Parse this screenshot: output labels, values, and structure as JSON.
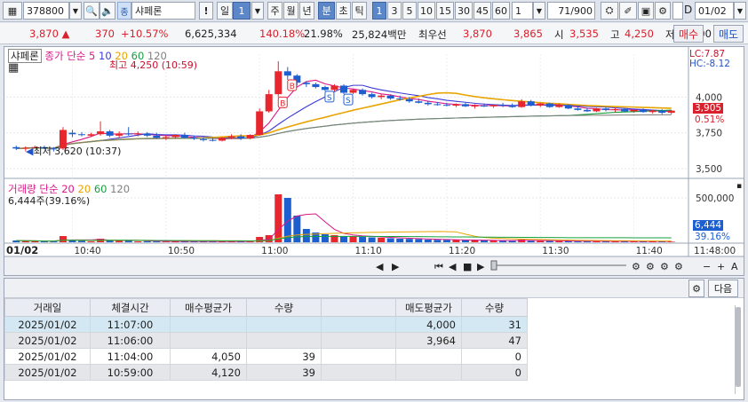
{
  "toolbar": {
    "code": "378800",
    "stock_name": "샤페론",
    "period_day": "일",
    "period_num": "1",
    "periods": [
      "주",
      "월",
      "년",
      "분",
      "초",
      "틱"
    ],
    "intervals": [
      "1",
      "3",
      "5",
      "10",
      "15",
      "30",
      "45",
      "60"
    ],
    "interval_select": "1",
    "count": "71",
    "count_max": "/900",
    "date": "01/02",
    "checkbox_label": "D"
  },
  "quote": {
    "price": "3,870",
    "change": "370",
    "change_pct": "+10.57%",
    "volume": "6,625,334",
    "vol_ratio": "140.18%",
    "turnover": "21.98%",
    "amount": "25,824백만",
    "ask_label": "최우선",
    "ask": "3,870",
    "bid": "3,865",
    "open_label": "시",
    "open": "3,535",
    "high_label": "고",
    "high": "4,250",
    "low_label": "저",
    "low": "3,500",
    "buy_label": "매수",
    "sell_label": "매도"
  },
  "chart": {
    "stock_tag": "샤페론",
    "legend_price": "종가 단순",
    "ma_periods": [
      "5",
      "10",
      "20",
      "60",
      "120"
    ],
    "high_note": "최고 4,250 (10:59)",
    "low_note": "최저 3,620 (10:37)",
    "lc": "LC:7.87",
    "hc": "HC:-8.12",
    "price_badge": "3,905",
    "pct_badge": "0.51%",
    "vol_legend": "거래량 단순",
    "vol_value": "6,444주(39.16%)",
    "vol_badge": "6,444",
    "vol_pct": "39.16%",
    "x_date": "01/02",
    "markers": [
      "B",
      "B",
      "S",
      "S"
    ],
    "colors": {
      "up": "#e8262d",
      "down": "#1e5fd0",
      "ma5": "#d9198a",
      "ma10": "#3b3bd6",
      "ma20": "#e8a400",
      "ma60": "#15a03c",
      "ma120": "#808080"
    }
  },
  "chart_data": [
    {
      "type": "candlestick",
      "title": "",
      "x": [
        "10:40",
        "10:50",
        "11:00",
        "11:10",
        "11:20",
        "11:30",
        "11:40",
        "11:48:00"
      ],
      "ylim": [
        3450,
        4300
      ],
      "yticks": [
        3500,
        3750,
        4000
      ],
      "y_tick_labels": [
        "3,500",
        "3,750",
        "4,000"
      ],
      "candles": [
        {
          "o": 3650,
          "h": 3660,
          "l": 3630,
          "c": 3640
        },
        {
          "o": 3640,
          "h": 3655,
          "l": 3620,
          "c": 3645
        },
        {
          "o": 3645,
          "h": 3660,
          "l": 3640,
          "c": 3650
        },
        {
          "o": 3650,
          "h": 3660,
          "l": 3635,
          "c": 3640
        },
        {
          "o": 3640,
          "h": 3650,
          "l": 3620,
          "c": 3635
        },
        {
          "o": 3640,
          "h": 3790,
          "l": 3630,
          "c": 3770
        },
        {
          "o": 3750,
          "h": 3770,
          "l": 3720,
          "c": 3740
        },
        {
          "o": 3740,
          "h": 3755,
          "l": 3725,
          "c": 3735
        },
        {
          "o": 3730,
          "h": 3750,
          "l": 3720,
          "c": 3740
        },
        {
          "o": 3740,
          "h": 3830,
          "l": 3730,
          "c": 3760
        },
        {
          "o": 3760,
          "h": 3770,
          "l": 3720,
          "c": 3730
        },
        {
          "o": 3730,
          "h": 3760,
          "l": 3715,
          "c": 3745
        },
        {
          "o": 3745,
          "h": 3790,
          "l": 3730,
          "c": 3740
        },
        {
          "o": 3740,
          "h": 3760,
          "l": 3725,
          "c": 3745
        },
        {
          "o": 3745,
          "h": 3755,
          "l": 3720,
          "c": 3730
        },
        {
          "o": 3730,
          "h": 3750,
          "l": 3710,
          "c": 3715
        },
        {
          "o": 3715,
          "h": 3735,
          "l": 3700,
          "c": 3720
        },
        {
          "o": 3720,
          "h": 3740,
          "l": 3710,
          "c": 3735
        },
        {
          "o": 3735,
          "h": 3750,
          "l": 3710,
          "c": 3715
        },
        {
          "o": 3715,
          "h": 3730,
          "l": 3700,
          "c": 3710
        },
        {
          "o": 3705,
          "h": 3720,
          "l": 3690,
          "c": 3700
        },
        {
          "o": 3700,
          "h": 3715,
          "l": 3690,
          "c": 3695
        },
        {
          "o": 3695,
          "h": 3720,
          "l": 3690,
          "c": 3715
        },
        {
          "o": 3715,
          "h": 3740,
          "l": 3705,
          "c": 3725
        },
        {
          "o": 3725,
          "h": 3740,
          "l": 3700,
          "c": 3710
        },
        {
          "o": 3710,
          "h": 3740,
          "l": 3705,
          "c": 3735
        },
        {
          "o": 3735,
          "h": 3920,
          "l": 3730,
          "c": 3900
        },
        {
          "o": 3900,
          "h": 4050,
          "l": 3890,
          "c": 4020
        },
        {
          "o": 4020,
          "h": 4250,
          "l": 4000,
          "c": 4180
        },
        {
          "o": 4180,
          "h": 4210,
          "l": 4120,
          "c": 4150
        },
        {
          "o": 4150,
          "h": 4160,
          "l": 4080,
          "c": 4100
        },
        {
          "o": 4100,
          "h": 4110,
          "l": 4070,
          "c": 4090
        },
        {
          "o": 4090,
          "h": 4100,
          "l": 4060,
          "c": 4070
        },
        {
          "o": 4070,
          "h": 4080,
          "l": 4040,
          "c": 4050
        },
        {
          "o": 4050,
          "h": 4090,
          "l": 4040,
          "c": 4080
        },
        {
          "o": 4080,
          "h": 4090,
          "l": 4020,
          "c": 4030
        },
        {
          "o": 4030,
          "h": 4060,
          "l": 4020,
          "c": 4050
        },
        {
          "o": 4050,
          "h": 4060,
          "l": 4010,
          "c": 4020
        },
        {
          "o": 4020,
          "h": 4030,
          "l": 3990,
          "c": 4000
        },
        {
          "o": 4000,
          "h": 4020,
          "l": 3985,
          "c": 4010
        },
        {
          "o": 4010,
          "h": 4020,
          "l": 3980,
          "c": 3990
        },
        {
          "o": 3990,
          "h": 4010,
          "l": 3975,
          "c": 3985
        },
        {
          "o": 3985,
          "h": 4000,
          "l": 3960,
          "c": 3970
        },
        {
          "o": 3970,
          "h": 3990,
          "l": 3955,
          "c": 3960
        },
        {
          "o": 3960,
          "h": 3975,
          "l": 3940,
          "c": 3950
        },
        {
          "o": 3950,
          "h": 3965,
          "l": 3940,
          "c": 3945
        },
        {
          "o": 3945,
          "h": 3960,
          "l": 3935,
          "c": 3940
        },
        {
          "o": 3940,
          "h": 3955,
          "l": 3930,
          "c": 3950
        },
        {
          "o": 3950,
          "h": 3960,
          "l": 3930,
          "c": 3935
        },
        {
          "o": 3935,
          "h": 3950,
          "l": 3920,
          "c": 3940
        },
        {
          "o": 3940,
          "h": 3955,
          "l": 3930,
          "c": 3935
        },
        {
          "o": 3935,
          "h": 3950,
          "l": 3925,
          "c": 3945
        },
        {
          "o": 3945,
          "h": 3960,
          "l": 3930,
          "c": 3940
        },
        {
          "o": 3940,
          "h": 3955,
          "l": 3925,
          "c": 3930
        },
        {
          "o": 3930,
          "h": 3985,
          "l": 3925,
          "c": 3970
        },
        {
          "o": 3970,
          "h": 3980,
          "l": 3935,
          "c": 3940
        },
        {
          "o": 3940,
          "h": 3960,
          "l": 3930,
          "c": 3955
        },
        {
          "o": 3955,
          "h": 3960,
          "l": 3925,
          "c": 3930
        },
        {
          "o": 3930,
          "h": 3955,
          "l": 3925,
          "c": 3945
        },
        {
          "o": 3945,
          "h": 3950,
          "l": 3915,
          "c": 3920
        },
        {
          "o": 3920,
          "h": 3940,
          "l": 3905,
          "c": 3910
        },
        {
          "o": 3910,
          "h": 3925,
          "l": 3895,
          "c": 3900
        },
        {
          "o": 3900,
          "h": 3925,
          "l": 3895,
          "c": 3920
        },
        {
          "o": 3920,
          "h": 3930,
          "l": 3900,
          "c": 3910
        },
        {
          "o": 3910,
          "h": 3925,
          "l": 3895,
          "c": 3915
        },
        {
          "o": 3915,
          "h": 3920,
          "l": 3895,
          "c": 3900
        },
        {
          "o": 3900,
          "h": 3915,
          "l": 3890,
          "c": 3910
        },
        {
          "o": 3910,
          "h": 3920,
          "l": 3890,
          "c": 3895
        },
        {
          "o": 3895,
          "h": 3910,
          "l": 3885,
          "c": 3905
        },
        {
          "o": 3905,
          "h": 3915,
          "l": 3880,
          "c": 3890
        },
        {
          "o": 3890,
          "h": 3910,
          "l": 3880,
          "c": 3905
        }
      ]
    },
    {
      "type": "bar",
      "title": "",
      "ylim": [
        0,
        560000
      ],
      "yticks": [
        500000
      ],
      "y_tick_labels": [
        "500,000"
      ],
      "values": [
        20000,
        15000,
        12000,
        10000,
        9000,
        70000,
        30000,
        15000,
        10000,
        40000,
        20000,
        15000,
        25000,
        10000,
        12000,
        9000,
        8000,
        10000,
        12000,
        9000,
        7000,
        6000,
        9000,
        11000,
        8000,
        10000,
        60000,
        80000,
        540000,
        500000,
        300000,
        150000,
        110000,
        90000,
        80000,
        70000,
        65000,
        60000,
        55000,
        50000,
        45000,
        40000,
        38000,
        35000,
        30000,
        28000,
        26000,
        25000,
        24000,
        22000,
        20000,
        19000,
        18000,
        17000,
        30000,
        16000,
        15000,
        14000,
        14000,
        13000,
        12000,
        12000,
        11000,
        11000,
        10000,
        10000,
        10000,
        9000,
        9000,
        9000,
        6444
      ]
    }
  ],
  "table": {
    "headers": [
      "거래일",
      "체결시간",
      "매수평균가",
      "수량",
      "",
      "매도평균가",
      "수량"
    ],
    "rows": [
      [
        "2025/01/02",
        "11:07:00",
        "",
        "",
        "",
        "4,000",
        "31"
      ],
      [
        "2025/01/02",
        "11:06:00",
        "",
        "",
        "",
        "3,964",
        "47"
      ],
      [
        "2025/01/02",
        "11:04:00",
        "4,050",
        "39",
        "",
        "",
        "0"
      ],
      [
        "2025/01/02",
        "10:59:00",
        "4,120",
        "39",
        "",
        "",
        "0"
      ]
    ],
    "next_label": "다음"
  }
}
